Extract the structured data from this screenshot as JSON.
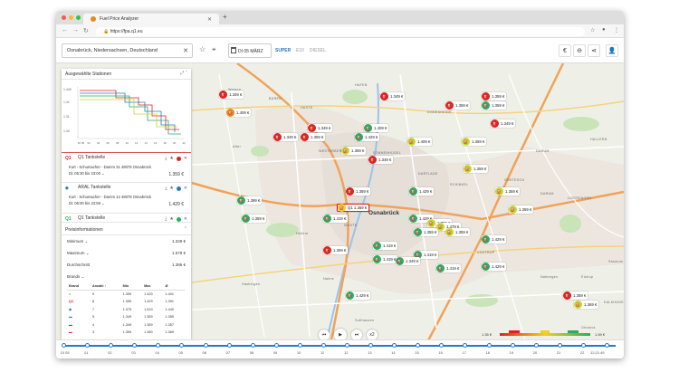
{
  "browser": {
    "tab_title": "Fuel Price Analyzer",
    "url": "https://fpa.q1.eu"
  },
  "toolbar": {
    "search_value": "Osnabrück, Niedersachsen, Deutschland",
    "date": "DI 05 MÄRZ",
    "fuels": [
      "SUPER",
      "E10",
      "DIESEL"
    ],
    "active_fuel": "SUPER"
  },
  "selected": {
    "title": "Ausgewählte Stationen",
    "y_ticks": [
      "1.449",
      "1.41",
      "1.31",
      "1.30"
    ],
    "x_ticks": [
      "DI 05",
      "02",
      "04",
      "06",
      "08",
      "10",
      "12",
      "14",
      "16",
      "18",
      "20",
      "22"
    ],
    "stations": [
      {
        "name": "Q1 Tankstelle",
        "address": "Kurt - Schumacher - Damm 31 49078 Osnabrück",
        "hours": "Di: 05:30 bis 23:00 ⌄",
        "price": "1.359 €",
        "color": "#e02020"
      },
      {
        "name": "ARAL Tankstelle",
        "address": "Kurt - Schumacher - Damm 12 49078 Osnabrück",
        "hours": "Di: 06:00 bis 23:59 ⌄",
        "price": "1.429 €",
        "color": "#2b78c2"
      },
      {
        "name": "Q1 Tankstelle",
        "color": "#27ae60"
      }
    ]
  },
  "prices": {
    "title": "Preisinformationen",
    "rows": [
      {
        "label": "Minimum ⌄",
        "value": "1.349 €"
      },
      {
        "label": "Maximum ⌄",
        "value": "1.579 €"
      },
      {
        "label": "Durchschnitt",
        "value": "1.386 €"
      }
    ],
    "brands_title": "Brands ⌄",
    "table_head": [
      "Brand",
      "Anzahl ↑",
      "Min",
      "Max",
      "Ø"
    ],
    "table_rows": [
      [
        "shell",
        "9",
        "1.359",
        "1.429",
        "1.401"
      ],
      [
        "q1",
        "8",
        "1.359",
        "1.429",
        "1.391"
      ],
      [
        "aral",
        "7",
        "1.379",
        "1.519",
        "1.440"
      ],
      [
        "blue",
        "5",
        "1.349",
        "1.359",
        "1.355"
      ],
      [
        "esso",
        "4",
        "1.349",
        "1.359",
        "1.357"
      ],
      [
        "avia",
        "3",
        "1.359",
        "1.389",
        "1.369"
      ]
    ]
  },
  "map": {
    "city": "Osnabrück",
    "places": [
      "Wersen",
      "BÜREN",
      "HASTE",
      "HAFEN",
      "Belm",
      "Atter",
      "WESTERBERG",
      "SCHINKEL",
      "DARUM",
      "GRETESCH",
      "LÜSTRINGEN",
      "DODESHEIDE",
      "SONNENHÜGEL",
      "DARTLAGE",
      "ESCH",
      "HALLERN",
      "WÜSTE",
      "Hellern",
      "Hasbergen",
      "Nahne",
      "Sutthausen",
      "VOXTRUP",
      "Nalbergen",
      "Eistrup",
      "Stockum",
      "KALKHÜGEL",
      "Ohrbeck",
      "DARUM"
    ],
    "pins": [
      {
        "price": "1.349 €",
        "color": "#e02020",
        "brand": "Q1"
      },
      {
        "price": "1.409 €",
        "color": "#e8891c",
        "brand": "S"
      },
      {
        "price": "1.349 €",
        "color": "#e02020",
        "brand": "Q1"
      },
      {
        "price": "1.349 €",
        "color": "#e02020",
        "brand": "Q1"
      },
      {
        "price": "1.349 €",
        "color": "#e02020",
        "brand": "Q1"
      },
      {
        "price": "1.409 €",
        "color": "#27ae60",
        "brand": "S"
      },
      {
        "price": "1.429 €",
        "color": "#27ae60",
        "brand": "S"
      },
      {
        "price": "1.359 €",
        "color": "#e02020",
        "brand": "Q1"
      },
      {
        "price": "1.359 €",
        "color": "#c6d92b",
        "brand": "Q1"
      },
      {
        "price": "1.349 €",
        "color": "#e02020",
        "brand": "Q1"
      },
      {
        "price": "1.399 €",
        "color": "#27ae60",
        "brand": "S"
      },
      {
        "price": "1.359 €",
        "color": "#27ae60",
        "brand": "S"
      },
      {
        "price": "1.419 €",
        "color": "#27ae60",
        "brand": "S"
      },
      {
        "price": "1.359 €",
        "color": "#e02020",
        "brand": "Q1"
      },
      {
        "price": "1.429 €",
        "color": "#27ae60",
        "brand": "A"
      },
      {
        "price": "1.359 €",
        "color": "#c6d92b",
        "brand": "Q1"
      },
      {
        "price": "1.359 €",
        "color": "#e02020",
        "brand": "Q1"
      },
      {
        "price": "1.409 €",
        "color": "#c6d92b",
        "brand": "S"
      },
      {
        "price": "1.359 €",
        "color": "#27ae60",
        "brand": "S"
      },
      {
        "price": "1.429 €",
        "color": "#27ae60",
        "brand": "A"
      },
      {
        "price": "1.419 €",
        "color": "#27ae60",
        "brand": "S"
      },
      {
        "price": "1.359 €",
        "color": "#27ae60",
        "brand": "S"
      },
      {
        "price": "1.419 €",
        "color": "#27ae60",
        "brand": "S"
      },
      {
        "price": "1.419 €",
        "color": "#27ae60",
        "brand": "S"
      },
      {
        "price": "1.429 €",
        "color": "#27ae60",
        "brand": "A"
      },
      {
        "price": "1.359 €",
        "color": "#c6d92b",
        "brand": "Q1"
      },
      {
        "price": "1.359 €",
        "color": "#e02020",
        "brand": "Q1"
      },
      {
        "price": "1.359 €",
        "color": "#c6d92b",
        "brand": "Q1"
      },
      {
        "price": "1.349 €",
        "color": "#e02020",
        "brand": "Q1"
      },
      {
        "price": "1.359 €",
        "color": "#c6d92b",
        "brand": "Q1"
      },
      {
        "price": "1.349 €",
        "color": "#27ae60",
        "brand": "S"
      },
      {
        "price": "1.359 €",
        "color": "#c6d92b",
        "brand": "Q1"
      },
      {
        "price": "1.419 €",
        "color": "#27ae60",
        "brand": "S"
      },
      {
        "price": "1.359 €",
        "color": "#e02020",
        "brand": "Q1"
      },
      {
        "price": "1.369 €",
        "color": "#c6d92b",
        "brand": "Q1"
      },
      {
        "price": "1.429 €",
        "color": "#27ae60",
        "brand": "S"
      },
      {
        "price": "1.479 €",
        "color": "#c6d92b",
        "brand": "A"
      },
      {
        "price": "1.359 €",
        "color": "#c6d92b",
        "brand": "Q1"
      },
      {
        "price": "1.429 €",
        "color": "#27ae60",
        "brand": "A"
      },
      {
        "price": "1.359 €",
        "color": "#e02020",
        "brand": "Q1"
      }
    ],
    "highlight": "Q1 1.359 €"
  },
  "player": {
    "speed": "x2"
  },
  "legend": {
    "min": "1.35 €",
    "max": "1.59 €",
    "ticks": [
      "1.37",
      "1.40",
      "1.45",
      "1.51",
      "1.56"
    ]
  },
  "timeline": {
    "labels": [
      "DI 05",
      "01",
      "02",
      "03",
      "04",
      "05",
      "06",
      "07",
      "08",
      "09",
      "10",
      "11",
      "12",
      "13",
      "14",
      "15",
      "16",
      "17",
      "18",
      "19",
      "20",
      "21",
      "22",
      "12:21:45"
    ]
  }
}
